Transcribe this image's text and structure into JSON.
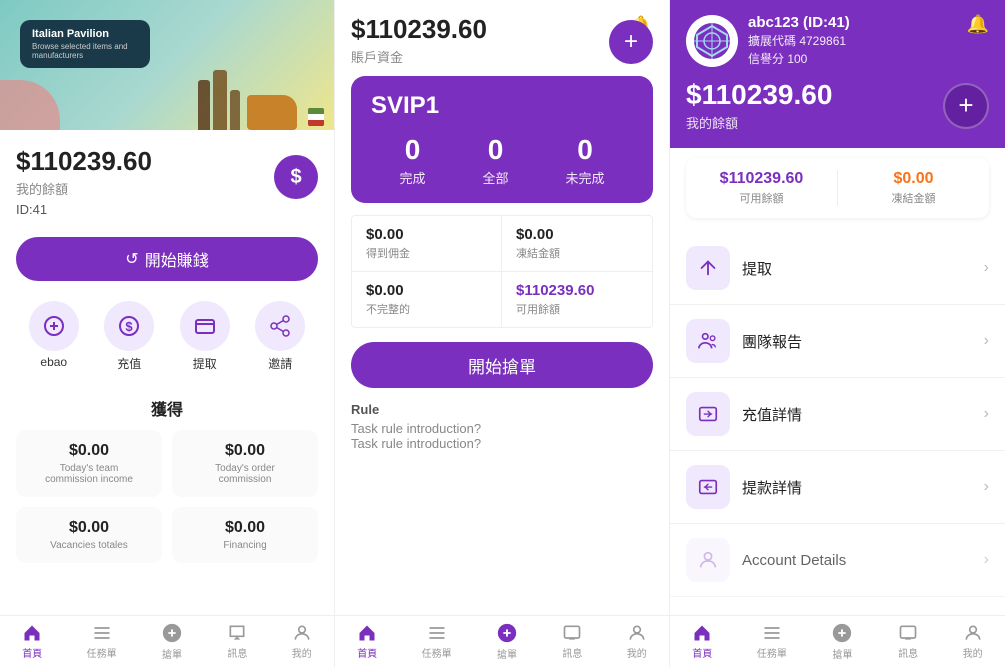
{
  "left": {
    "banner": {
      "card_title": "Italian Pavilion",
      "card_sub": "Browse selected items and manufacturers"
    },
    "balance": "$110239.60",
    "balance_label": "我的餘額",
    "id": "ID:41",
    "dollar_btn": "$",
    "start_btn": "開始賺錢",
    "icons": [
      {
        "label": "ebao",
        "icon": "ebao"
      },
      {
        "label": "充值",
        "icon": "dollar"
      },
      {
        "label": "提取",
        "icon": "card"
      },
      {
        "label": "邀請",
        "icon": "share"
      }
    ],
    "earn_title": "獲得",
    "earn_row1": [
      {
        "amount": "$0.00",
        "desc": "Today's team\ncommission income"
      },
      {
        "amount": "$0.00",
        "desc": "Today's order\ncommission"
      }
    ],
    "earn_row2": [
      {
        "amount": "$0.00",
        "desc": "Vacancies totales"
      },
      {
        "amount": "$0.00",
        "desc": "Financing"
      }
    ],
    "nav": [
      {
        "label": "首頁",
        "icon": "home",
        "active": true
      },
      {
        "label": "任務單",
        "icon": "list"
      },
      {
        "label": "搶單",
        "icon": "grab"
      },
      {
        "label": "訊息",
        "icon": "msg"
      },
      {
        "label": "我的",
        "icon": "user"
      }
    ]
  },
  "mid": {
    "balance": "$110239.60",
    "balance_label": "賬戶資金",
    "svip": {
      "title": "SVIP1",
      "stats": [
        {
          "num": "0",
          "label": "完成"
        },
        {
          "num": "0",
          "label": "全部"
        },
        {
          "num": "0",
          "label": "未完成"
        }
      ]
    },
    "info_cells": [
      {
        "amount": "$0.00",
        "label": "得到佣金"
      },
      {
        "amount": "$0.00",
        "label": "凍結金額"
      },
      {
        "amount": "$0.00",
        "label": "不完整的"
      },
      {
        "amount": "$110239.60",
        "label": "可用餘額",
        "purple": true
      }
    ],
    "grab_btn": "開始搶單",
    "rule_title": "Rule",
    "rule_lines": [
      "Task rule introduction?",
      "Task rule introduction?"
    ],
    "nav": [
      {
        "label": "首頁",
        "icon": "home",
        "active": true
      },
      {
        "label": "任務單",
        "icon": "list"
      },
      {
        "label": "搶單",
        "icon": "grab"
      },
      {
        "label": "訊息",
        "icon": "msg"
      },
      {
        "label": "我的",
        "icon": "user"
      }
    ]
  },
  "right": {
    "username": "abc123 (ID:41)",
    "agent_code": "擴展代碼 4729861",
    "score": "信譽分 100",
    "balance": "$110239.60",
    "balance_label": "我的餘額",
    "available": "$110239.60",
    "available_label": "可用餘額",
    "frozen": "$0.00",
    "frozen_label": "凍結金額",
    "menu_items": [
      {
        "label": "提取",
        "icon": "arrow-up"
      },
      {
        "label": "團隊報告",
        "icon": "team"
      },
      {
        "label": "充值詳情",
        "icon": "recharge"
      },
      {
        "label": "提款詳情",
        "icon": "withdraw"
      },
      {
        "label": "Account Details",
        "icon": "account"
      }
    ],
    "nav": [
      {
        "label": "首頁",
        "icon": "home",
        "active": true
      },
      {
        "label": "任務單",
        "icon": "list"
      },
      {
        "label": "搶單",
        "icon": "grab"
      },
      {
        "label": "訊息",
        "icon": "msg"
      },
      {
        "label": "我的",
        "icon": "user"
      }
    ]
  }
}
